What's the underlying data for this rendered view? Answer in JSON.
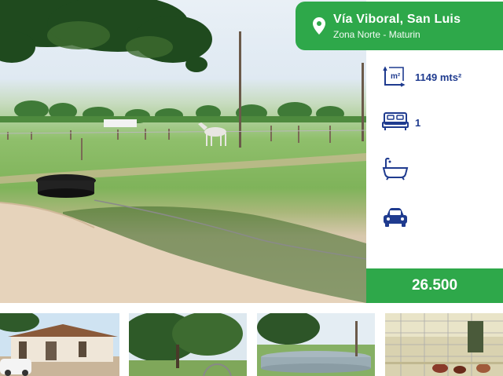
{
  "listing": {
    "title": "Vía  Viboral, San Luis",
    "subtitle": "Zona Norte - Maturin",
    "price": "26.500",
    "colors": {
      "accent_green": "#2ea84a",
      "feature_blue": "#1f3b8f"
    }
  },
  "features": [
    {
      "icon": "area-icon",
      "value": "1149 mts²"
    },
    {
      "icon": "bed-icon",
      "value": "1"
    },
    {
      "icon": "bathtub-icon",
      "value": ""
    },
    {
      "icon": "car-icon",
      "value": ""
    }
  ],
  "gallery": [
    {
      "name": "thumbnail-house"
    },
    {
      "name": "thumbnail-trees"
    },
    {
      "name": "thumbnail-water-tank"
    },
    {
      "name": "thumbnail-chicken-coop"
    }
  ]
}
